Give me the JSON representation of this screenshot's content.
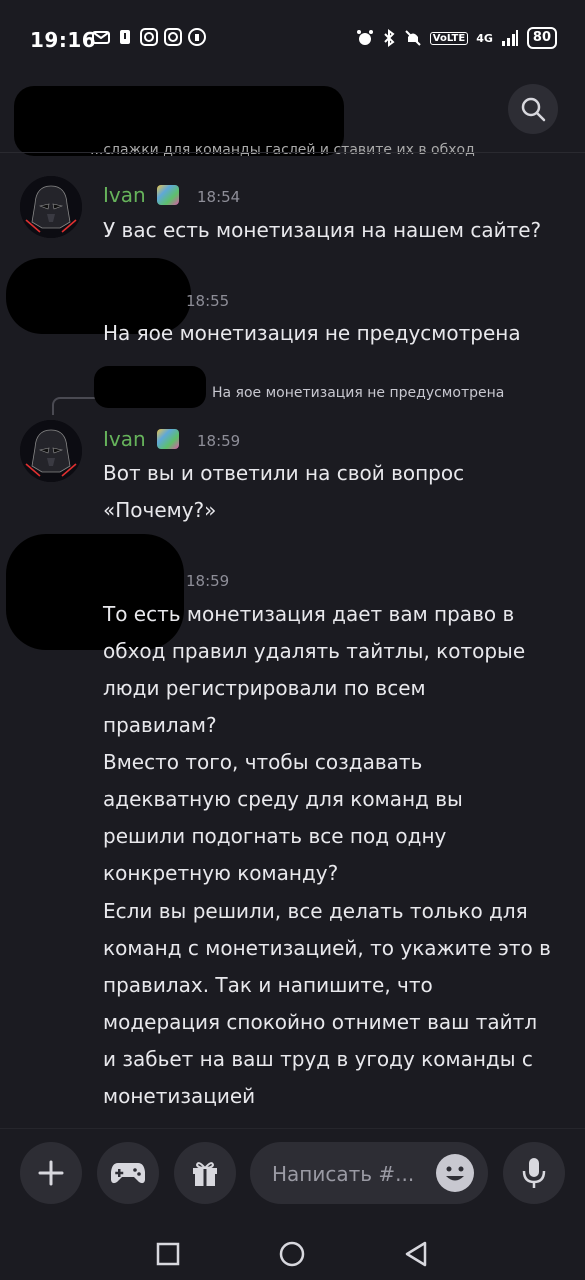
{
  "status_bar": {
    "time": "19:16",
    "battery": "80",
    "network": "4G",
    "volte": "VoLTE"
  },
  "header": {
    "topic_partial": "...слажки для команды гаслей и ставите их в обход"
  },
  "messages": [
    {
      "author": "Ivan",
      "time": "18:54",
      "text": "У вас есть монетизация на нашем сайте?"
    },
    {
      "author": "",
      "time": "18:55",
      "text": "На яое монетизация не предусмотрена"
    },
    {
      "reply_to": "На яое монетизация не предусмотрена",
      "author": "Ivan",
      "time": "18:59",
      "text_lines": [
        "Вот вы и ответили на свой вопрос",
        "«Почему?»"
      ]
    },
    {
      "author": "",
      "time": "18:59",
      "paragraphs": [
        [
          "То есть монетизация дает вам право в",
          "обход правил удалять тайтлы, которые",
          "люди регистрировали по всем",
          "правилам?"
        ],
        [
          "Вместо того, чтобы создавать",
          "адекватную среду для команд вы",
          "решили подогнать все под одну",
          "конкретную команду?"
        ],
        [
          "Если вы решили, все делать только для",
          "команд с монетизацией, то укажите это в",
          "правилах. Так и напишите, что",
          "модерация спокойно отнимет ваш тайтл",
          "и забьет на ваш труд в угоду команды с",
          "монетизацией"
        ]
      ]
    }
  ],
  "composer": {
    "placeholder": "Написать #..."
  },
  "icons": {
    "search": "search-icon",
    "add": "plus-icon",
    "games": "gamepad-icon",
    "gift": "gift-icon",
    "emoji": "emoji-icon",
    "mic": "microphone-icon"
  },
  "colors": {
    "background": "#1b1b21",
    "author": "#66b35b",
    "button": "#2d2d34"
  }
}
